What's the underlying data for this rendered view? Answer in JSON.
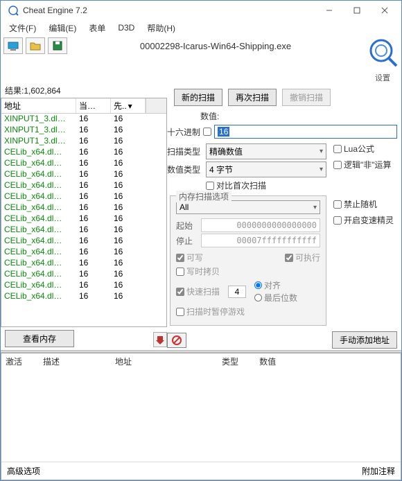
{
  "title": "Cheat Engine 7.2",
  "menu": {
    "file": "文件(F)",
    "edit": "编辑(E)",
    "table": "表单",
    "d3d": "D3D",
    "help": "帮助(H)"
  },
  "process": "00002298-Icarus-Win64-Shipping.exe",
  "settings_label": "设置",
  "results_label": "结果:1,602,864",
  "table_headers": {
    "addr": "地址",
    "cur": "当…",
    "prev": "先..",
    "sort": "▾"
  },
  "rows": [
    {
      "addr": "XINPUT1_3.dl…",
      "cur": "16",
      "prev": "16"
    },
    {
      "addr": "XINPUT1_3.dl…",
      "cur": "16",
      "prev": "16"
    },
    {
      "addr": "XINPUT1_3.dl…",
      "cur": "16",
      "prev": "16"
    },
    {
      "addr": "CELib_x64.dl…",
      "cur": "16",
      "prev": "16"
    },
    {
      "addr": "CELib_x64.dl…",
      "cur": "16",
      "prev": "16"
    },
    {
      "addr": "CELib_x64.dl…",
      "cur": "16",
      "prev": "16"
    },
    {
      "addr": "CELib_x64.dl…",
      "cur": "16",
      "prev": "16"
    },
    {
      "addr": "CELib_x64.dl…",
      "cur": "16",
      "prev": "16"
    },
    {
      "addr": "CELib_x64.dl…",
      "cur": "16",
      "prev": "16"
    },
    {
      "addr": "CELib_x64.dl…",
      "cur": "16",
      "prev": "16"
    },
    {
      "addr": "CELib_x64.dl…",
      "cur": "16",
      "prev": "16"
    },
    {
      "addr": "CELib_x64.dl…",
      "cur": "16",
      "prev": "16"
    },
    {
      "addr": "CELib_x64.dl…",
      "cur": "16",
      "prev": "16"
    },
    {
      "addr": "CELib_x64.dl…",
      "cur": "16",
      "prev": "16"
    },
    {
      "addr": "CELib_x64.dl…",
      "cur": "16",
      "prev": "16"
    },
    {
      "addr": "CELib_x64.dl…",
      "cur": "16",
      "prev": "16"
    },
    {
      "addr": "CELib_x64.dl…",
      "cur": "16",
      "prev": "16"
    }
  ],
  "view_memory": "查看内存",
  "btn": {
    "newscan": "新的扫描",
    "nextscan": "再次扫描",
    "undoscan": "撤销扫描"
  },
  "value_label": "数值:",
  "hex_label": "十六进制",
  "hex_value": "16",
  "scan_type_label": "扫描类型",
  "scan_type_value": "精确数值",
  "value_type_label": "数值类型",
  "value_type_value": "4 字节",
  "lua_formula": "Lua公式",
  "not_op": "逻辑\"非\"运算",
  "compare_first": "对比首次扫描",
  "disable_random": "禁止随机",
  "speedhack": "开启变速精灵",
  "mem_group": {
    "title": "内存扫描选项",
    "all": "All",
    "start_label": "起始",
    "start_value": "0000000000000000",
    "stop_label": "停止",
    "stop_value": "00007fffffffffff",
    "writable": "可写",
    "executable": "可执行",
    "copy_on_write": "写时拷贝",
    "fast_scan": "快速扫描",
    "fast_value": "4",
    "align": "对齐",
    "last_digits": "最后位数",
    "pause_while": "扫描时暂停游戏"
  },
  "add_address": "手动添加地址",
  "lower_headers": {
    "active": "激活",
    "desc": "描述",
    "addr": "地址",
    "type": "类型",
    "value": "数值"
  },
  "adv_options": "高级选项",
  "attach_comment": "附加注释"
}
